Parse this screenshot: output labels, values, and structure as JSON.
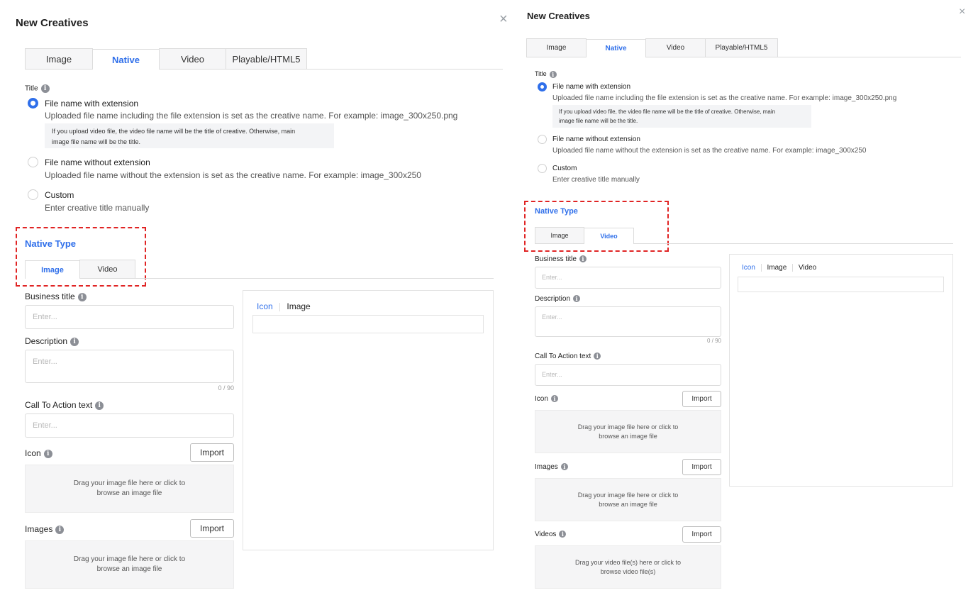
{
  "left": {
    "title": "New Creatives",
    "close_icon": "×",
    "tabs": [
      "Image",
      "Native",
      "Video",
      "Playable/HTML5"
    ],
    "title_label": "Title",
    "options": [
      {
        "label": "File name with extension",
        "desc": "Uploaded file name including the file extension is set as the creative name. For example: image_300x250.png",
        "selected": true
      },
      {
        "label": "File name without extension",
        "desc": "Uploaded file name without the extension is set as the creative name. For example: image_300x250",
        "selected": false
      },
      {
        "label": "Custom",
        "desc": "Enter creative title manually",
        "selected": false
      }
    ],
    "note_line1": "If you upload video file, the video file name will be the title of creative. Otherwise, main",
    "note_line2": "image file name will be the title.",
    "native_type": "Native Type",
    "native_tabs": [
      "Image",
      "Video"
    ],
    "business_title": "Business title",
    "business_placeholder": "Enter...",
    "description": "Description",
    "description_placeholder": "Enter...",
    "counter": "0 / 90",
    "cta": "Call To Action text",
    "cta_placeholder": "Enter...",
    "icon": "Icon",
    "import": "Import",
    "drop_line1": "Drag your image file here or click to",
    "drop_line2": "browse an image file",
    "images": "Images",
    "preview_tabs": [
      "Icon",
      "Image"
    ]
  },
  "right": {
    "title": "New Creatives",
    "close_icon": "×",
    "tabs": [
      "Image",
      "Native",
      "Video",
      "Playable/HTML5"
    ],
    "title_label": "Title",
    "options": [
      {
        "label": "File name with extension",
        "desc": "Uploaded file name including the file extension is set as the creative name. For example: image_300x250.png",
        "selected": true
      },
      {
        "label": "File name without extension",
        "desc": "Uploaded file name without the extension is set as the creative name. For example: image_300x250",
        "selected": false
      },
      {
        "label": "Custom",
        "desc": "Enter creative title manually",
        "selected": false
      }
    ],
    "note_line1": "If you upload video file, the video file name will be the title of creative. Otherwise, main",
    "note_line2": "image file name will be the title.",
    "native_type": "Native Type",
    "native_tabs": [
      "Image",
      "Video"
    ],
    "business_title": "Business title",
    "business_placeholder": "Enter...",
    "description": "Description",
    "description_placeholder": "Enter...",
    "counter": "0 / 90",
    "cta": "Call To Action text",
    "cta_placeholder": "Enter...",
    "icon": "Icon",
    "import": "Import",
    "drop_line1": "Drag your image file here or click to",
    "drop_line2": "browse an image file",
    "images": "Images",
    "videos": "Videos",
    "drop_video_line1": "Drag your video file(s) here or click to",
    "drop_video_line2": "browse video file(s)",
    "preview_tabs": [
      "Icon",
      "Image",
      "Video"
    ]
  },
  "colors": {
    "accent": "#2f6fea",
    "highlight_border": "#e02424"
  },
  "info_icon_glyph": "i"
}
